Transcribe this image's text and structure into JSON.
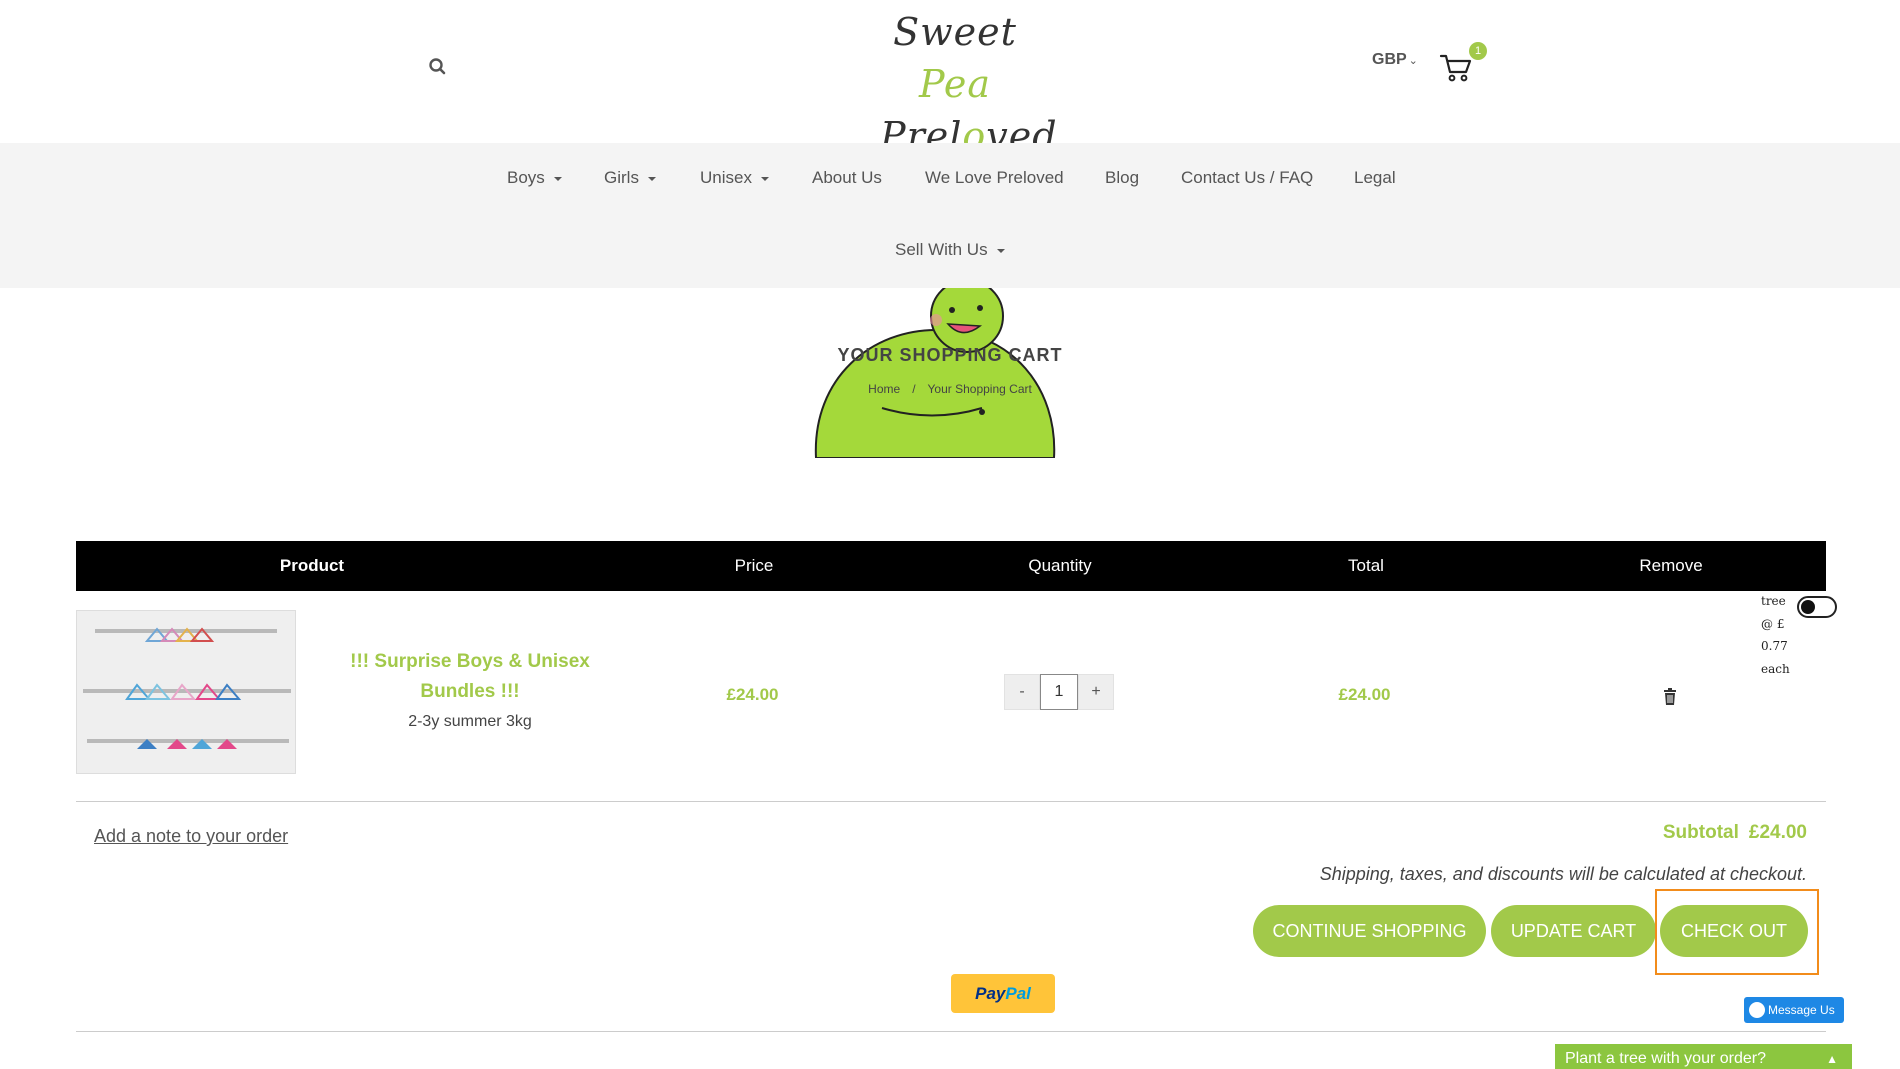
{
  "header": {
    "logo_line1_a": "Sweet ",
    "logo_line1_b": "Pea",
    "logo_line2_a": "Prel",
    "logo_line2_b": "o",
    "logo_line2_c": "ved",
    "currency": "GBP",
    "cart_count": "1",
    "icons": [
      "search-icon",
      "cart-icon",
      "chevron-down-icon"
    ]
  },
  "nav": {
    "items": [
      {
        "label": "Boys"
      },
      {
        "label": "Girls"
      },
      {
        "label": "Unisex"
      },
      {
        "label": "About Us"
      },
      {
        "label": "We Love Preloved"
      },
      {
        "label": "Blog"
      },
      {
        "label": "Contact Us / FAQ"
      },
      {
        "label": "Legal"
      },
      {
        "label": "Sell With Us"
      }
    ]
  },
  "hero": {
    "title": "YOUR SHOPPING CART",
    "breadcrumb_home": "Home",
    "breadcrumb_sep": "/",
    "breadcrumb_current": "Your Shopping Cart"
  },
  "table": {
    "headers": [
      "Product",
      "Price",
      "Quantity",
      "Total",
      "Remove"
    ]
  },
  "cart_item": {
    "name": "!!! Surprise Boys & Unisex Bundles !!!",
    "variant": "2-3y summer 3kg",
    "price": "£24.00",
    "quantity": "1",
    "qty_minus": "-",
    "qty_plus": "+",
    "total": "£24.00"
  },
  "tree_offer": {
    "line1": "tree",
    "line2": "@ £",
    "line3": "0.77",
    "line4": "each"
  },
  "summary": {
    "note_link": "Add a note to your order",
    "subtotal_label": "Subtotal",
    "subtotal_amount": "£24.00",
    "shipping_note": "Shipping, taxes, and discounts will be calculated at checkout.",
    "continue_label": "CONTINUE SHOPPING",
    "update_label": "UPDATE CART",
    "checkout_label": "CHECK OUT",
    "paypal_a": "Pay",
    "paypal_b": "Pal"
  },
  "widgets": {
    "messenger_label": "Message Us",
    "tree_bar_label": "Plant a tree with your order?"
  },
  "colors": {
    "accent": "#a2c94a",
    "highlight": "#f28c1b",
    "paypal": "#ffc439",
    "messenger": "#1e88e5"
  }
}
